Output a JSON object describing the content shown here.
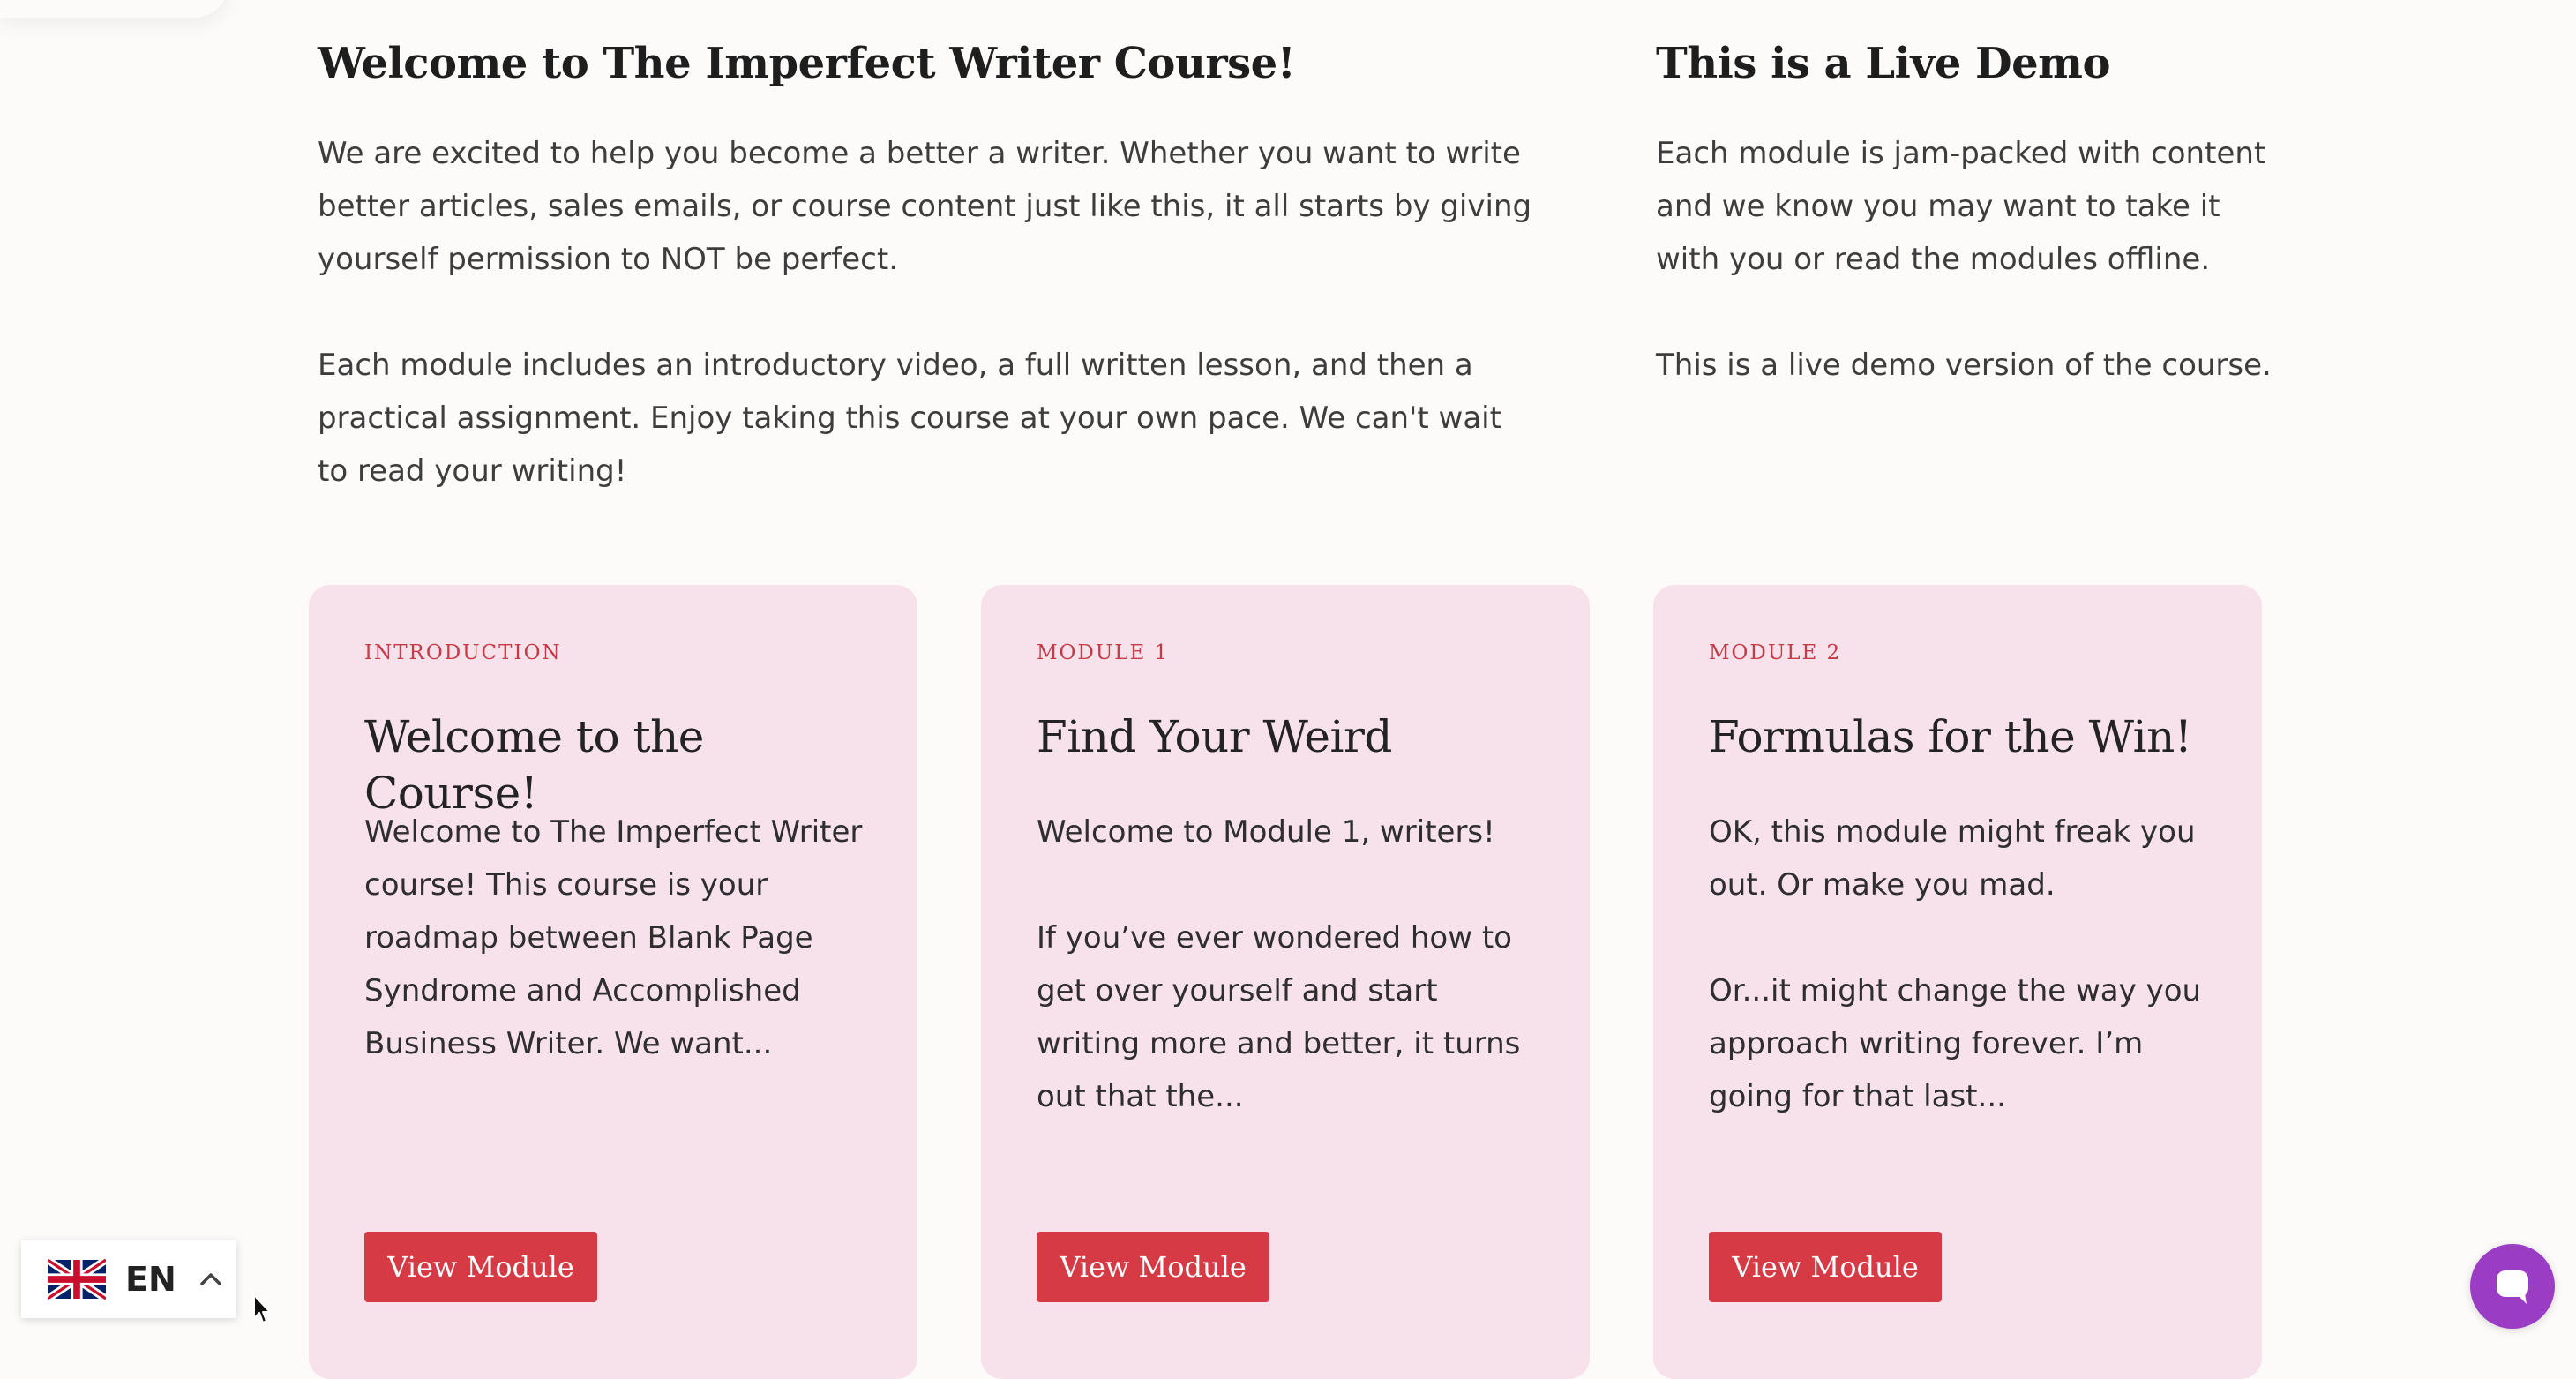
{
  "intro": {
    "left": {
      "title": "Welcome to The Imperfect Writer Course!",
      "paragraph1": "We are excited to help you become a better a writer. Whether you want to write better articles, sales emails, or course content just like this, it all starts by giving yourself permission to NOT be perfect.",
      "paragraph2": "Each module includes an introductory video, a full written lesson, and then a practical assignment. Enjoy taking this course at your own pace. We can't wait to read your writing!"
    },
    "right": {
      "title": "This is a Live Demo",
      "paragraph1": "Each module is jam-packed with content and we know you may want to take it with you or read the modules offline.",
      "paragraph2": "This is a live demo version of the course."
    }
  },
  "cards": [
    {
      "eyebrow": "INTRODUCTION",
      "title": "Welcome to the Course!",
      "body1": "Welcome to The Imperfect Writer course! This course is your roadmap between Blank Page Syndrome and Accomplished Business Writer. We want...",
      "body2": "",
      "button": "View Module"
    },
    {
      "eyebrow": "MODULE 1",
      "title": "Find Your Weird",
      "body1": "Welcome to Module 1, writers!",
      "body2": "If you’ve ever wondered how to get over yourself and start writing more and better, it turns out that the...",
      "button": "View Module"
    },
    {
      "eyebrow": "MODULE 2",
      "title": "Formulas for the Win!",
      "body1": "OK, this module might freak you out. Or make you mad.",
      "body2": "Or...it might change the way you approach writing forever. I’m going for that last...",
      "button": "View Module"
    }
  ],
  "language_switcher": {
    "code": "EN",
    "flag_icon": "uk-flag-icon"
  },
  "chat": {
    "icon": "chat-bubble-icon"
  },
  "colors": {
    "background": "#fcfbfa",
    "card_bg": "#f7e1ea",
    "accent": "#d63b45",
    "chat": "#9a3cc4"
  }
}
